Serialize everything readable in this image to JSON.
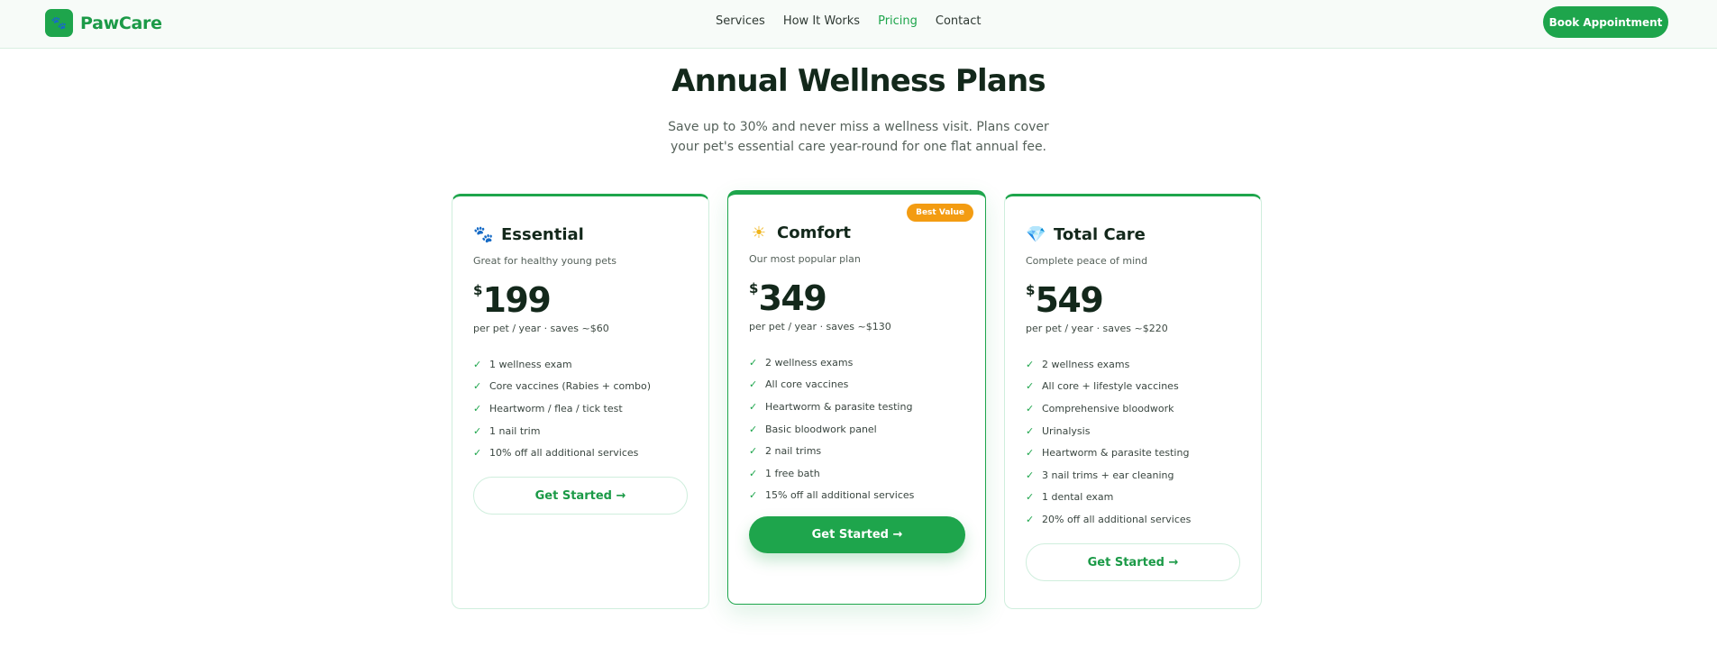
{
  "header": {
    "logo_icon": "paw-icon",
    "logo_text": "PawCare",
    "nav": [
      {
        "label": "Services",
        "active": false
      },
      {
        "label": "How It Works",
        "active": false
      },
      {
        "label": "Pricing",
        "active": true
      },
      {
        "label": "Contact",
        "active": false
      }
    ],
    "cta_label": "Book Appointment"
  },
  "hero": {
    "title": "Annual Wellness Plans",
    "subtitle": "Save up to 30% and never miss a wellness visit. Plans cover your pet's essential care year-round for one flat annual fee."
  },
  "plans": [
    {
      "icon": "paw-icon",
      "icon_glyph": "🐾",
      "name": "Essential",
      "tagline": "Great for healthy young pets",
      "currency": "$",
      "price": "199",
      "price_note": "per pet / year · saves ~$60",
      "features": [
        "1 wellness exam",
        "Core vaccines (Rabies + combo)",
        "Heartworm / flea / tick test",
        "1 nail trim",
        "10% off all additional services"
      ],
      "cta_label": "Get Started →",
      "featured": false
    },
    {
      "icon": "sun-icon",
      "icon_glyph": "☀",
      "name": "Comfort",
      "tagline": "Our most popular plan",
      "badge": "Best Value",
      "currency": "$",
      "price": "349",
      "price_note": "per pet / year · saves ~$130",
      "features": [
        "2 wellness exams",
        "All core vaccines",
        "Heartworm & parasite testing",
        "Basic bloodwork panel",
        "2 nail trims",
        "1 free bath",
        "15% off all additional services"
      ],
      "cta_label": "Get Started →",
      "featured": true
    },
    {
      "icon": "gem-icon",
      "icon_glyph": "💎",
      "name": "Total Care",
      "tagline": "Complete peace of mind",
      "currency": "$",
      "price": "549",
      "price_note": "per pet / year · saves ~$220",
      "features": [
        "2 wellness exams",
        "All core + lifestyle vaccines",
        "Comprehensive bloodwork",
        "Urinalysis",
        "Heartworm & parasite testing",
        "3 nail trims + ear cleaning",
        "1 dental exam",
        "20% off all additional services"
      ],
      "cta_label": "Get Started →",
      "featured": false
    }
  ],
  "colors": {
    "brand": "#1ea54c",
    "badge": "#f39c12",
    "heading": "#13281b"
  },
  "check_glyph": "✓"
}
